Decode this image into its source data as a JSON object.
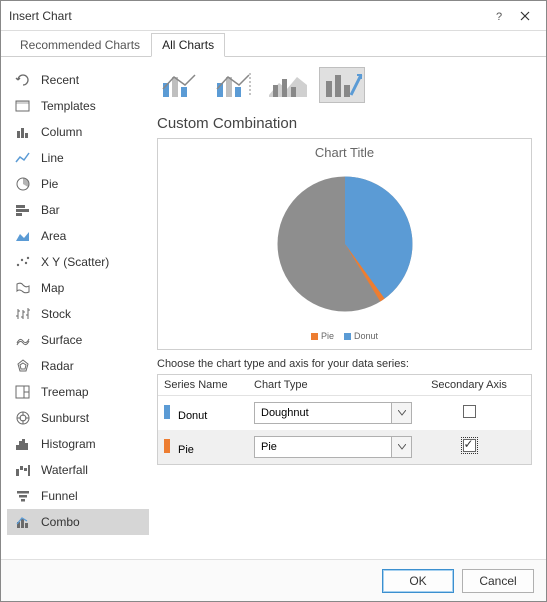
{
  "window": {
    "title": "Insert Chart"
  },
  "tabs": {
    "recommended": "Recommended Charts",
    "all": "All Charts"
  },
  "sidebar": {
    "items": [
      {
        "label": "Recent",
        "icon": "recent-icon"
      },
      {
        "label": "Templates",
        "icon": "templates-icon"
      },
      {
        "label": "Column",
        "icon": "column-icon"
      },
      {
        "label": "Line",
        "icon": "line-icon"
      },
      {
        "label": "Pie",
        "icon": "pie-icon"
      },
      {
        "label": "Bar",
        "icon": "bar-icon"
      },
      {
        "label": "Area",
        "icon": "area-icon"
      },
      {
        "label": "X Y (Scatter)",
        "icon": "scatter-icon"
      },
      {
        "label": "Map",
        "icon": "map-icon"
      },
      {
        "label": "Stock",
        "icon": "stock-icon"
      },
      {
        "label": "Surface",
        "icon": "surface-icon"
      },
      {
        "label": "Radar",
        "icon": "radar-icon"
      },
      {
        "label": "Treemap",
        "icon": "treemap-icon"
      },
      {
        "label": "Sunburst",
        "icon": "sunburst-icon"
      },
      {
        "label": "Histogram",
        "icon": "histogram-icon"
      },
      {
        "label": "Waterfall",
        "icon": "waterfall-icon"
      },
      {
        "label": "Funnel",
        "icon": "funnel-icon"
      },
      {
        "label": "Combo",
        "icon": "combo-icon"
      }
    ],
    "selected": 17
  },
  "combo": {
    "subtitle": "Custom Combination"
  },
  "preview": {
    "chart_title": "Chart Title",
    "legend": [
      {
        "label": "Pie",
        "color": "#ed7d31"
      },
      {
        "label": "Donut",
        "color": "#5b9bd5"
      }
    ]
  },
  "series": {
    "instruction": "Choose the chart type and axis for your data series:",
    "headers": {
      "name": "Series Name",
      "type": "Chart Type",
      "axis": "Secondary Axis"
    },
    "rows": [
      {
        "swatch": "#5b9bd5",
        "name": "Donut",
        "type": "Doughnut",
        "secondary": false
      },
      {
        "swatch": "#ed7d31",
        "name": "Pie",
        "type": "Pie",
        "secondary": true
      }
    ]
  },
  "footer": {
    "ok": "OK",
    "cancel": "Cancel"
  },
  "chart_data": {
    "type": "pie",
    "title": "Chart Title",
    "series": [
      {
        "name": "Donut",
        "color": "#5b9bd5",
        "value": 40
      },
      {
        "name": "Pie (gray)",
        "color": "#8e8e8e",
        "value": 59
      },
      {
        "name": "Pie (orange)",
        "color": "#ed7d31",
        "value": 1
      }
    ],
    "legend_position": "bottom"
  }
}
